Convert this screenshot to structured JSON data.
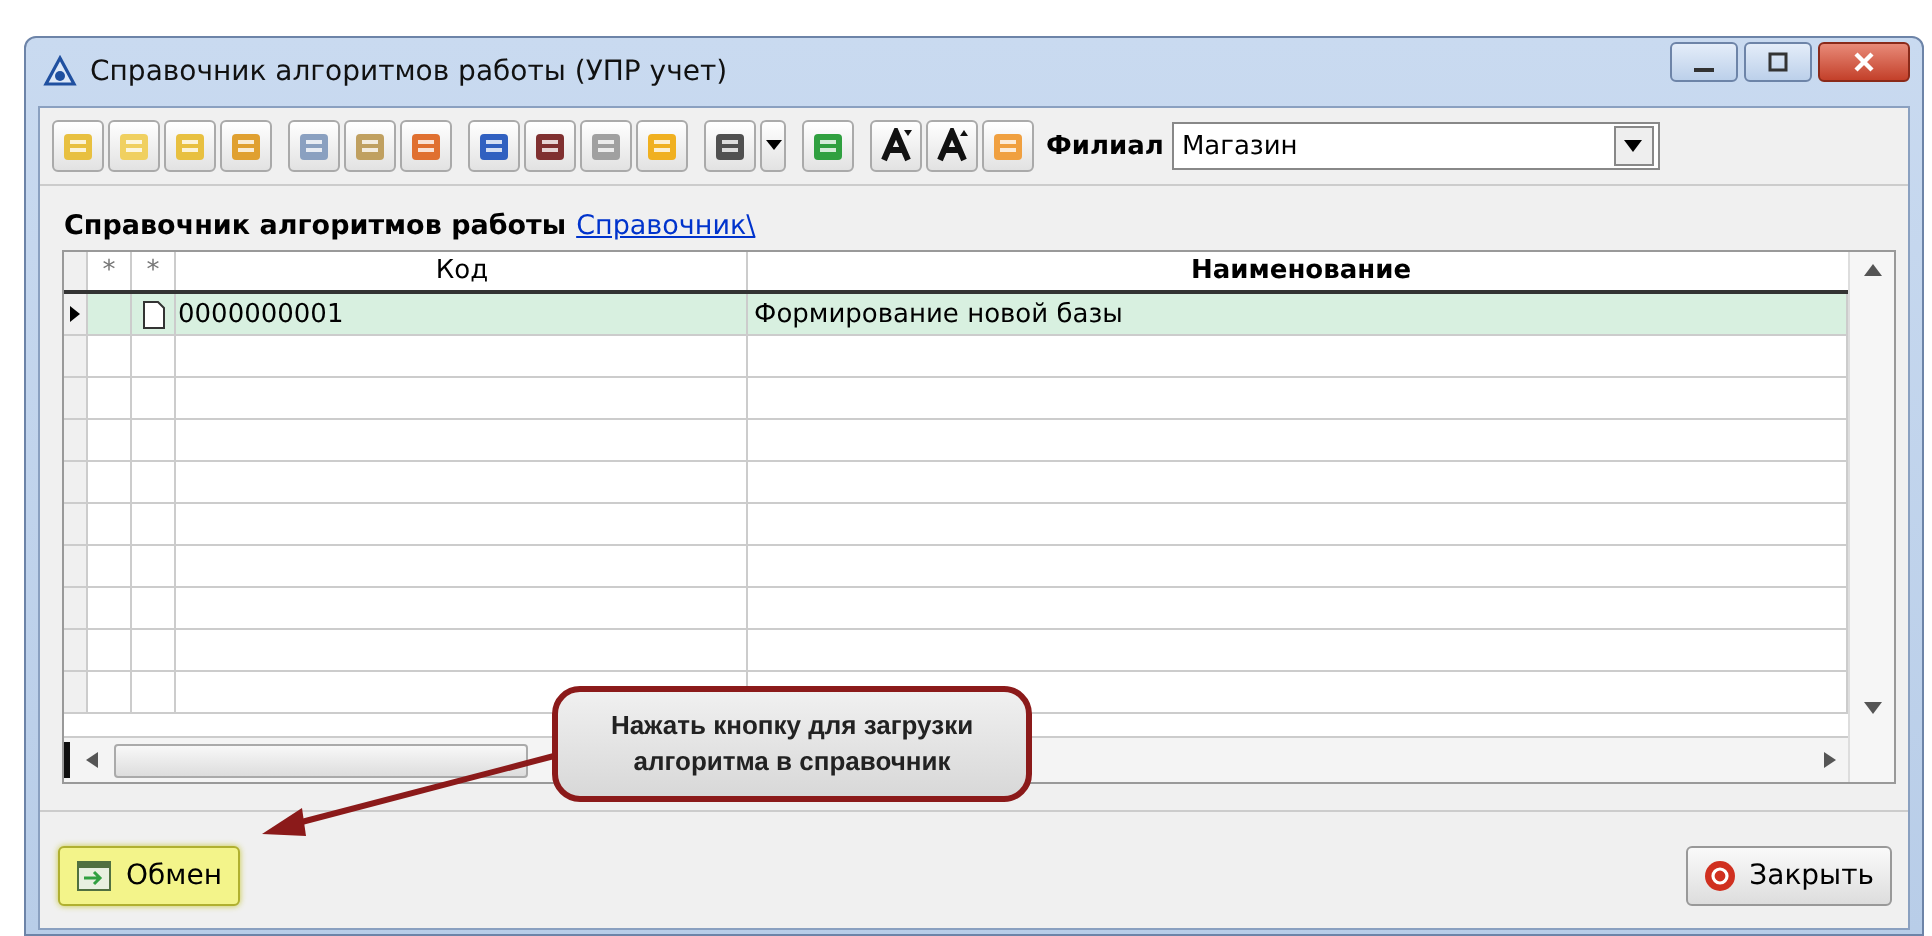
{
  "window": {
    "title": "Справочник алгоритмов работы (УПР учет)"
  },
  "toolbar": {
    "filter_label": "Филиал",
    "filter_value": "Магазин"
  },
  "header": {
    "title": "Справочник алгоритмов работы",
    "link": "Справочник\\"
  },
  "table": {
    "marker_columns": [
      "*",
      "*"
    ],
    "columns": [
      "Код",
      "Наименование"
    ],
    "rows": [
      {
        "code": "0000000001",
        "name": "Формирование новой базы",
        "selected": true
      }
    ]
  },
  "callout": {
    "text": "Нажать кнопку для загрузки алгоритма в справочник"
  },
  "buttons": [
    {
      "label": "Обмен",
      "kind": "exchange",
      "highlighted": true
    },
    {
      "label": "Закрыть",
      "kind": "close",
      "highlighted": false
    }
  ]
}
